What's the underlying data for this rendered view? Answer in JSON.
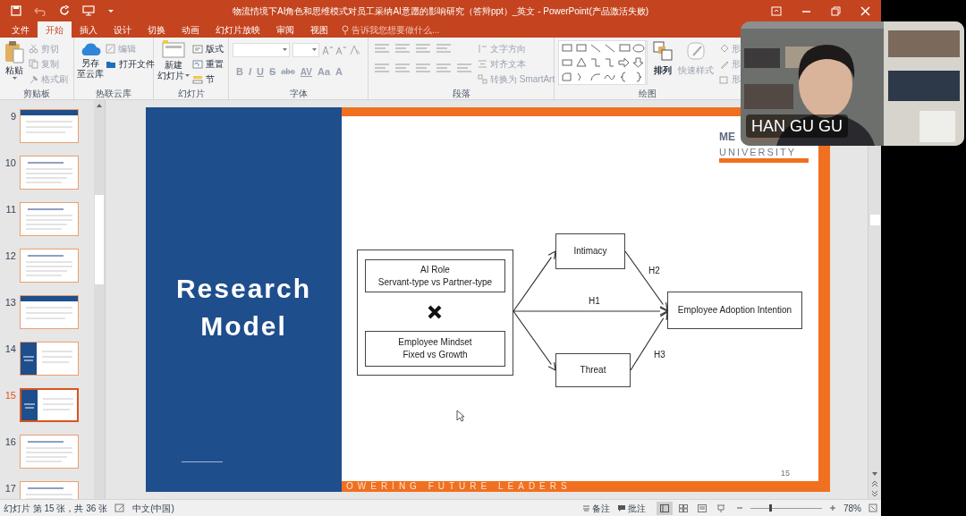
{
  "window": {
    "title": "物流情境下AI角色和思维模式对员工采纳AI意愿的影响研究（答辩ppt）_英文 - PowerPoint(产品激活失败)"
  },
  "tabs": [
    {
      "label": "文件",
      "selected": false
    },
    {
      "label": "开始",
      "selected": true
    },
    {
      "label": "插入",
      "selected": false
    },
    {
      "label": "设计",
      "selected": false
    },
    {
      "label": "切换",
      "selected": false
    },
    {
      "label": "动画",
      "selected": false
    },
    {
      "label": "幻灯片放映",
      "selected": false
    },
    {
      "label": "审阅",
      "selected": false
    },
    {
      "label": "视图",
      "selected": false
    }
  ],
  "tell_me": {
    "placeholder": "告诉我您想要做什么..."
  },
  "ribbon": {
    "groups": [
      {
        "label": "剪贴板",
        "big": [
          "粘贴"
        ],
        "small": [
          {
            "label": "剪切",
            "disabled": true
          },
          {
            "label": "复制",
            "disabled": true
          },
          {
            "label": "格式刷",
            "disabled": true
          }
        ]
      },
      {
        "label": "热联云库",
        "big": [
          "另存",
          "至云库"
        ],
        "small": [
          {
            "label": "编辑",
            "disabled": true
          },
          {
            "label": "打开文件",
            "disabled": false
          }
        ]
      },
      {
        "label": "幻灯片",
        "big": [
          "新建",
          "幻灯片"
        ],
        "small": [
          {
            "label": "版式",
            "disabled": false
          },
          {
            "label": "重置",
            "disabled": false
          },
          {
            "label": "节",
            "disabled": false
          }
        ]
      },
      {
        "label": "字体",
        "buttons": [
          "B",
          "I",
          "U",
          "S",
          "abc",
          "AV",
          "Aa",
          "A"
        ]
      },
      {
        "label": "段落",
        "small": [
          {
            "label": "文字方向",
            "disabled": true
          },
          {
            "label": "对齐文本",
            "disabled": true
          },
          {
            "label": "转换为 SmartArt",
            "disabled": true
          }
        ]
      },
      {
        "label": "绘图",
        "big": [
          "排列",
          "快速样式"
        ],
        "small": [
          {
            "label": "形",
            "disabled": true
          },
          {
            "label": "形",
            "disabled": true
          },
          {
            "label": "形",
            "disabled": true
          }
        ]
      }
    ]
  },
  "thumbnails": [
    {
      "number": "9",
      "kind": "banner",
      "selected": false
    },
    {
      "number": "10",
      "kind": "plain",
      "selected": false
    },
    {
      "number": "11",
      "kind": "plain",
      "selected": false
    },
    {
      "number": "12",
      "kind": "plain",
      "selected": false
    },
    {
      "number": "13",
      "kind": "banner",
      "selected": false
    },
    {
      "number": "14",
      "kind": "split",
      "selected": false
    },
    {
      "number": "15",
      "kind": "split",
      "selected": true
    },
    {
      "number": "16",
      "kind": "plain",
      "selected": false
    },
    {
      "number": "17",
      "kind": "plain",
      "selected": false
    }
  ],
  "slide": {
    "title": "Research Model",
    "logo": [
      "ME",
      "UNIVERSITY"
    ],
    "footer": "OWERING FUTURE LEADERS",
    "page_number": "15",
    "diagram": {
      "nodes": [
        {
          "lines": [
            "AI Role",
            "Servant-type vs Partner-type"
          ]
        },
        {
          "lines": [
            "Employee Mindset",
            "Fixed vs Growth"
          ]
        },
        {
          "lines": [
            "Intimacy"
          ]
        },
        {
          "lines": [
            "Threat"
          ]
        },
        {
          "lines": [
            "Employee Adoption Intention"
          ]
        }
      ],
      "edge_labels": [
        "H1",
        "H2",
        "H3"
      ]
    }
  },
  "webcam": {
    "name": "HAN GU GU"
  },
  "status_bar": {
    "slide_info": "幻灯片 第 15 张，共 36 张",
    "language": "中文(中国)",
    "notes": "备注",
    "comments": "批注",
    "zoom": "78%",
    "zoom_level": {
      "level": 0.28
    }
  }
}
